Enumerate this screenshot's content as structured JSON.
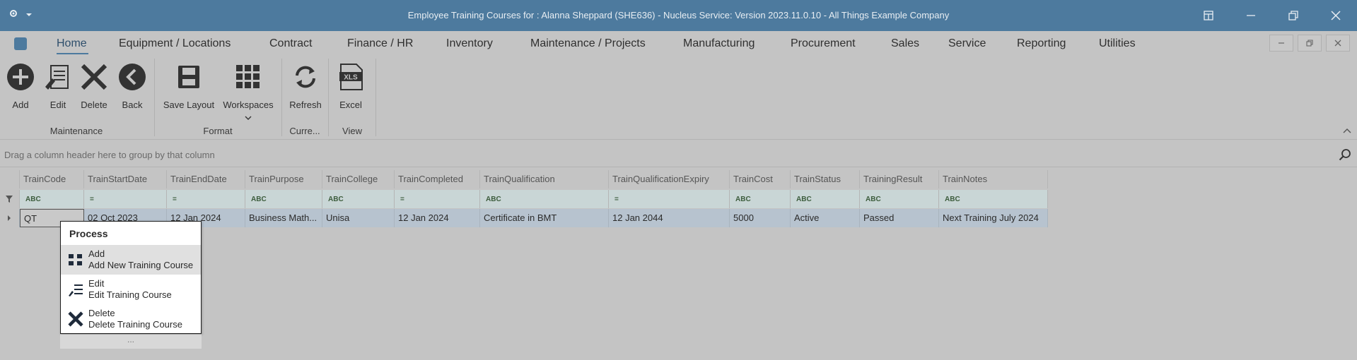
{
  "window": {
    "title": "Employee Training Courses for : Alanna Sheppard (SHE636) - Nucleus Service: Version 2023.11.0.10 - All Things Example Company"
  },
  "menu": {
    "items": [
      "Home",
      "Equipment / Locations",
      "Contract",
      "Finance / HR",
      "Inventory",
      "Maintenance / Projects",
      "Manufacturing",
      "Procurement",
      "Sales",
      "Service",
      "Reporting",
      "Utilities"
    ],
    "active": "Home"
  },
  "ribbon": {
    "buttons": {
      "add": "Add",
      "edit": "Edit",
      "delete": "Delete",
      "back": "Back",
      "save_layout": "Save Layout",
      "workspaces": "Workspaces",
      "refresh": "Refresh",
      "excel": "Excel"
    },
    "groups": {
      "maintenance": "Maintenance",
      "format": "Format",
      "current": "Curre...",
      "view": "View"
    }
  },
  "group_panel": {
    "hint": "Drag a column header here to group by that column"
  },
  "grid": {
    "columns": [
      "TrainCode",
      "TrainStartDate",
      "TrainEndDate",
      "TrainPurpose",
      "TrainCollege",
      "TrainCompleted",
      "TrainQualification",
      "TrainQualificationExpiry",
      "TrainCost",
      "TrainStatus",
      "TrainingResult",
      "TrainNotes"
    ],
    "filter_glyphs": [
      "ABC",
      "=",
      "=",
      "ABC",
      "ABC",
      "=",
      "ABC",
      "=",
      "ABC",
      "ABC",
      "ABC",
      "ABC"
    ],
    "rows": [
      [
        "QT",
        "02 Oct 2023",
        "12 Jan 2024",
        "Business Math...",
        "Unisa",
        "12 Jan 2024",
        "Certificate in BMT",
        "12 Jan 2044",
        "5000",
        "Active",
        "Passed",
        "Next Training July 2024"
      ]
    ]
  },
  "context_menu": {
    "header": "Process",
    "items": [
      {
        "title": "Add",
        "subtitle": "Add New Training Course",
        "icon": "grid-icon"
      },
      {
        "title": "Edit",
        "subtitle": "Edit Training Course",
        "icon": "edit-list-icon"
      },
      {
        "title": "Delete",
        "subtitle": "Delete Training Course",
        "icon": "delete-x-icon"
      }
    ],
    "more": "..."
  },
  "colors": {
    "titlebar": "#4d7a9e",
    "background": "#c4c4c4",
    "selected_row": "#b7c3cf"
  }
}
